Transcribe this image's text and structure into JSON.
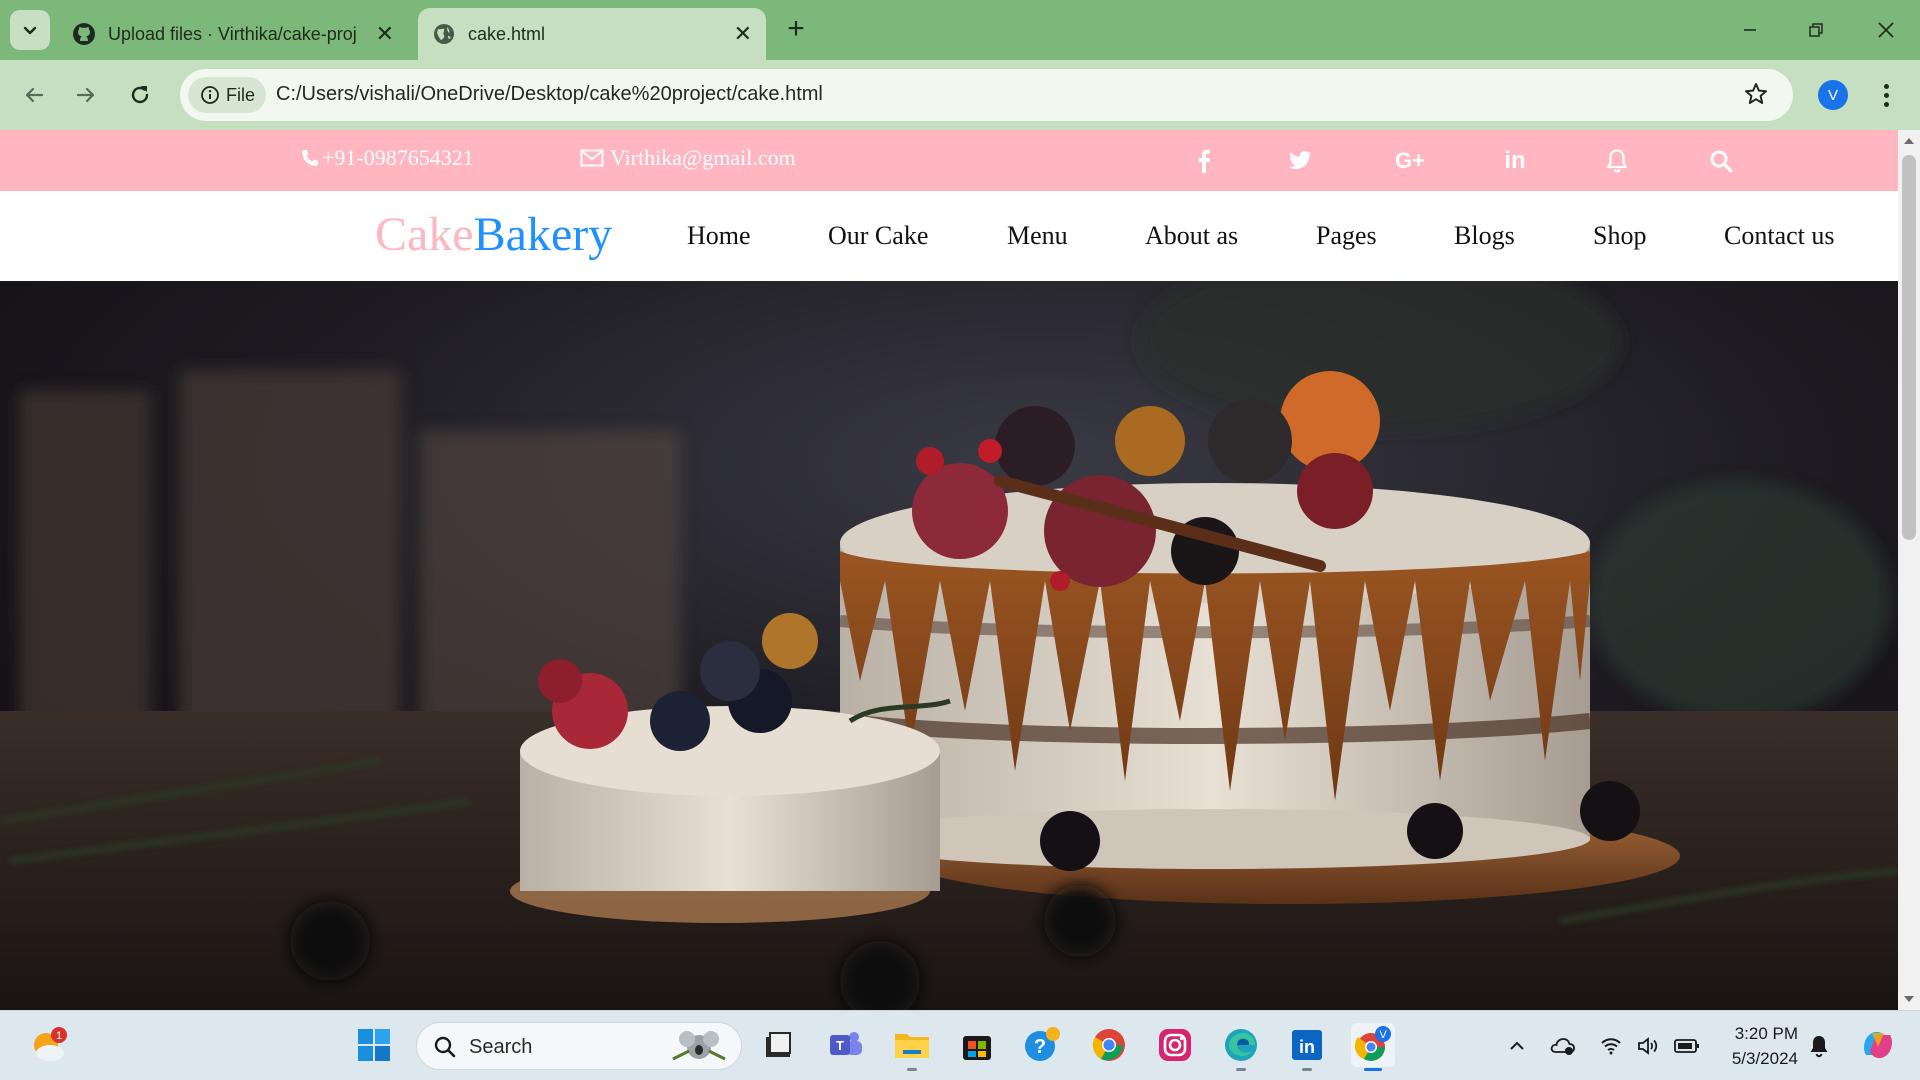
{
  "browser": {
    "tabs": [
      {
        "title": "Upload files · Virthika/cake-proj",
        "icon": "github-icon",
        "active": false
      },
      {
        "title": "cake.html",
        "icon": "globe-icon",
        "active": true
      }
    ],
    "new_tab_symbol": "+",
    "address": {
      "chip": "File",
      "url": "C:/Users/vishali/OneDrive/Desktop/cake%20project/cake.html"
    },
    "profile_initial": "V",
    "colors": {
      "frame": "#7cb879",
      "toolbar": "#c6dfc0",
      "profile": "#1a73e8"
    }
  },
  "page": {
    "topbar": {
      "phone": "+91-0987654321",
      "email": "Virthika@gmail.com",
      "social_icons": [
        "facebook-icon",
        "twitter-icon",
        "google-plus-icon",
        "linkedin-icon",
        "bell-icon",
        "search-icon"
      ],
      "google_plus_text": "G+",
      "linkedin_text": "in",
      "background": "#ffb6c1"
    },
    "logo": {
      "part1": "Cake",
      "part2": "Bakery",
      "color1": "#ffb6c1",
      "color2": "#1e90ff"
    },
    "nav": [
      "Home",
      "Our Cake",
      "Menu",
      "About as",
      "Pages",
      "Blogs",
      "Shop",
      "Contact us"
    ],
    "hero": {
      "subject": "cake-photo"
    }
  },
  "taskbar": {
    "weather_badge": "1",
    "search_placeholder": "Search",
    "apps": [
      "start-icon",
      "file-viewer-icon",
      "teams-icon",
      "file-explorer-icon",
      "store-icon",
      "help-icon",
      "chrome-icon",
      "instagram-icon",
      "edge-icon",
      "linkedin-icon",
      "chrome-profile-icon"
    ],
    "linkedin_text": "in",
    "profile_badge": "V",
    "clock": {
      "time": "3:20 PM",
      "date": "5/3/2024"
    }
  }
}
